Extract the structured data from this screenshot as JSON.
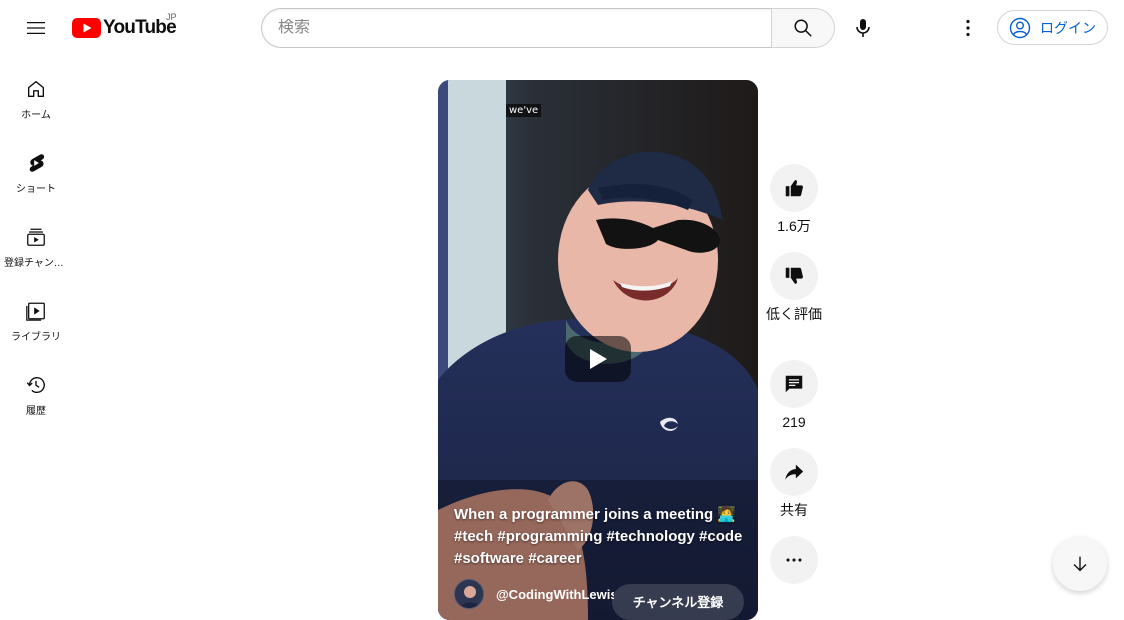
{
  "header": {
    "logo_text": "YouTube",
    "region_code": "JP",
    "search_placeholder": "検索",
    "login_label": "ログイン"
  },
  "sidebar": {
    "items": [
      {
        "label": "ホーム",
        "icon": "home-icon"
      },
      {
        "label": "ショート",
        "icon": "shorts-icon"
      },
      {
        "label": "登録チャンネル",
        "icon": "subscriptions-icon"
      },
      {
        "label": "ライブラリ",
        "icon": "library-icon"
      },
      {
        "label": "履歴",
        "icon": "history-icon"
      }
    ]
  },
  "video": {
    "caption_chip": "we've",
    "title": "When a programmer joins a meeting 🧑‍💻 #tech #programming #technology #code #software #career",
    "channel_name": "@CodingWithLewis",
    "subscribe_label": "チャンネル登録"
  },
  "actions": {
    "like_count": "1.6万",
    "dislike_label": "低く評価",
    "comment_count": "219",
    "share_label": "共有"
  },
  "colors": {
    "brand_red": "#ff0000",
    "link_blue": "#065fd4",
    "action_bg": "#f2f2f2"
  }
}
